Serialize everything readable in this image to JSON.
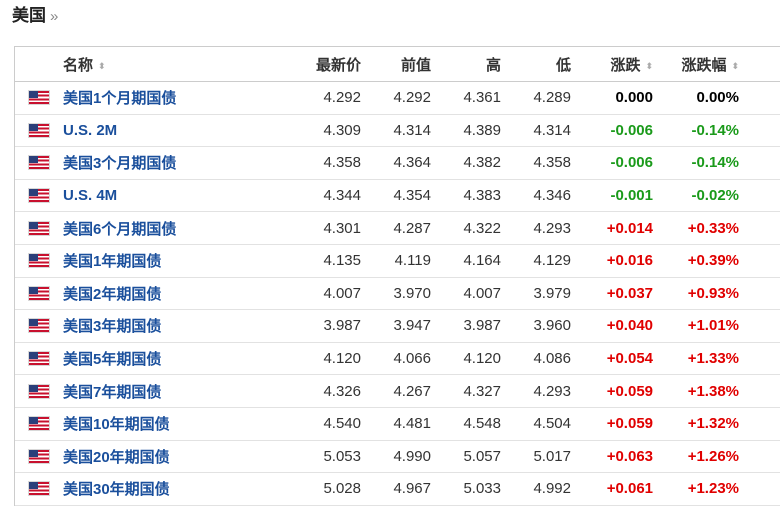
{
  "section": {
    "title": "美国",
    "chevron": "»"
  },
  "table": {
    "headers": {
      "name": "名称",
      "last": "最新价",
      "prev": "前值",
      "high": "高",
      "low": "低",
      "change": "涨跌",
      "change_pct": "涨跌幅"
    },
    "sort_glyph": "⬍",
    "rows": [
      {
        "name": "美国1个月期国债",
        "last": "4.292",
        "prev": "4.292",
        "high": "4.361",
        "low": "4.289",
        "change": "0.000",
        "change_pct": "0.00%",
        "dir": "zero"
      },
      {
        "name": "U.S. 2M",
        "last": "4.309",
        "prev": "4.314",
        "high": "4.389",
        "low": "4.314",
        "change": "-0.006",
        "change_pct": "-0.14%",
        "dir": "neg"
      },
      {
        "name": "美国3个月期国债",
        "last": "4.358",
        "prev": "4.364",
        "high": "4.382",
        "low": "4.358",
        "change": "-0.006",
        "change_pct": "-0.14%",
        "dir": "neg"
      },
      {
        "name": "U.S. 4M",
        "last": "4.344",
        "prev": "4.354",
        "high": "4.383",
        "low": "4.346",
        "change": "-0.001",
        "change_pct": "-0.02%",
        "dir": "neg"
      },
      {
        "name": "美国6个月期国债",
        "last": "4.301",
        "prev": "4.287",
        "high": "4.322",
        "low": "4.293",
        "change": "+0.014",
        "change_pct": "+0.33%",
        "dir": "pos"
      },
      {
        "name": "美国1年期国债",
        "last": "4.135",
        "prev": "4.119",
        "high": "4.164",
        "low": "4.129",
        "change": "+0.016",
        "change_pct": "+0.39%",
        "dir": "pos"
      },
      {
        "name": "美国2年期国债",
        "last": "4.007",
        "prev": "3.970",
        "high": "4.007",
        "low": "3.979",
        "change": "+0.037",
        "change_pct": "+0.93%",
        "dir": "pos"
      },
      {
        "name": "美国3年期国债",
        "last": "3.987",
        "prev": "3.947",
        "high": "3.987",
        "low": "3.960",
        "change": "+0.040",
        "change_pct": "+1.01%",
        "dir": "pos"
      },
      {
        "name": "美国5年期国债",
        "last": "4.120",
        "prev": "4.066",
        "high": "4.120",
        "low": "4.086",
        "change": "+0.054",
        "change_pct": "+1.33%",
        "dir": "pos"
      },
      {
        "name": "美国7年期国债",
        "last": "4.326",
        "prev": "4.267",
        "high": "4.327",
        "low": "4.293",
        "change": "+0.059",
        "change_pct": "+1.38%",
        "dir": "pos"
      },
      {
        "name": "美国10年期国债",
        "last": "4.540",
        "prev": "4.481",
        "high": "4.548",
        "low": "4.504",
        "change": "+0.059",
        "change_pct": "+1.32%",
        "dir": "pos"
      },
      {
        "name": "美国20年期国债",
        "last": "5.053",
        "prev": "4.990",
        "high": "5.057",
        "low": "5.017",
        "change": "+0.063",
        "change_pct": "+1.26%",
        "dir": "pos"
      },
      {
        "name": "美国30年期国债",
        "last": "5.028",
        "prev": "4.967",
        "high": "5.033",
        "low": "4.992",
        "change": "+0.061",
        "change_pct": "+1.23%",
        "dir": "pos"
      }
    ]
  },
  "icons": {
    "flag": "us-flag-icon",
    "sort": "sort-icon"
  },
  "colors": {
    "positive": "#e00000",
    "negative": "#1a9a1a",
    "link": "#1a4f9c"
  }
}
